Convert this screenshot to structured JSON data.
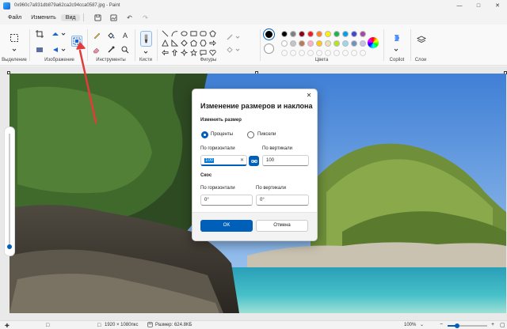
{
  "window": {
    "title": "0x960c7a931db879a62ca2c94cca0587.jpg - Paint"
  },
  "menu": {
    "file": "Файл",
    "edit": "Изменить",
    "view": "Вид"
  },
  "ribbon": {
    "selection_label": "Выделение",
    "image_label": "Изображение",
    "tools_label": "Инструменты",
    "brushes_label": "Кисти",
    "shapes_label": "Фигуры",
    "colors_label": "Цвета",
    "copilot_label": "Copilot",
    "layers_label": "Слои"
  },
  "colors": {
    "accent": "#005fb8",
    "palette_row1": [
      "#000000",
      "#7f7f7f",
      "#880015",
      "#ed1c24",
      "#ff7f27",
      "#fff200",
      "#22b14c",
      "#00a2e8",
      "#3f48cc",
      "#a349a4"
    ],
    "palette_row2": [
      "#ffffff",
      "#c3c3c3",
      "#b97a57",
      "#ffaec9",
      "#ffc90e",
      "#efe4b0",
      "#b5e61d",
      "#99d9ea",
      "#7092be",
      "#c8bfe7"
    ]
  },
  "dialog": {
    "title": "Изменение размеров и наклона",
    "resize_section": "Изменить размер",
    "percent_option": "Проценты",
    "pixels_option": "Пиксели",
    "horizontal_label": "По горизонтали",
    "vertical_label": "По вертикали",
    "resize_horizontal_value": "100",
    "resize_vertical_value": "100",
    "skew_section": "Скос",
    "skew_horizontal_label": "По горизонтали",
    "skew_vertical_label": "По вертикали",
    "skew_horizontal_value": "0°",
    "skew_vertical_value": "0°",
    "ok_label": "OK",
    "cancel_label": "Отмена"
  },
  "status": {
    "dimensions": "1920 × 1080пкс",
    "size": "Размер: 624.8КБ",
    "zoom": "100%"
  }
}
